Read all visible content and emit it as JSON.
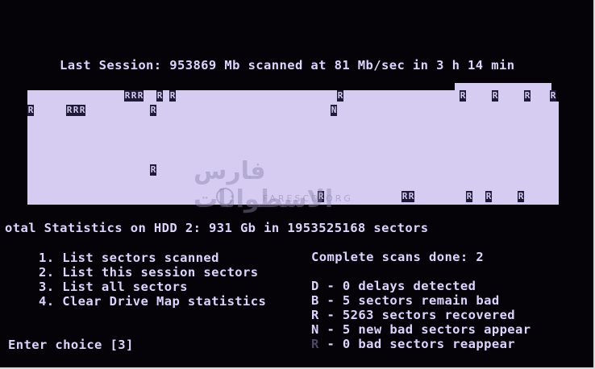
{
  "session_line": "Last Session: 953869 Mb scanned at 81 Mb/sec in 3 h 14 min",
  "drive_map": {
    "bad_marker": "R",
    "new_marker": "N"
  },
  "total_statistics": "otal Statistics on HDD 2: 931 Gb in 1953525168 sectors",
  "menu": [
    "1. List sectors scanned",
    "2. List this session sectors",
    "3. List all sectors",
    "4. Clear Drive Map statistics"
  ],
  "prompt": "Enter choice [3]",
  "scans_done": "Complete scans done: 2",
  "legend": [
    {
      "key": "D",
      "text": " - 0 delays detected"
    },
    {
      "key": "B",
      "text": " - 5 sectors remain bad"
    },
    {
      "key": "R",
      "text": " - 5263 sectors recovered"
    },
    {
      "key": "N",
      "text": " - 5 new bad sectors appear"
    },
    {
      "key": "R",
      "text": " - 0 bad sectors reappear"
    }
  ],
  "watermark": {
    "arabic": "فارس الاسطوانات",
    "latin": "FARESCD.ORG"
  },
  "colors": {
    "text": "#ddd5ff",
    "background": "#050307",
    "map_fill": "#d6ccf2",
    "map_mark": "#1f1a36"
  }
}
